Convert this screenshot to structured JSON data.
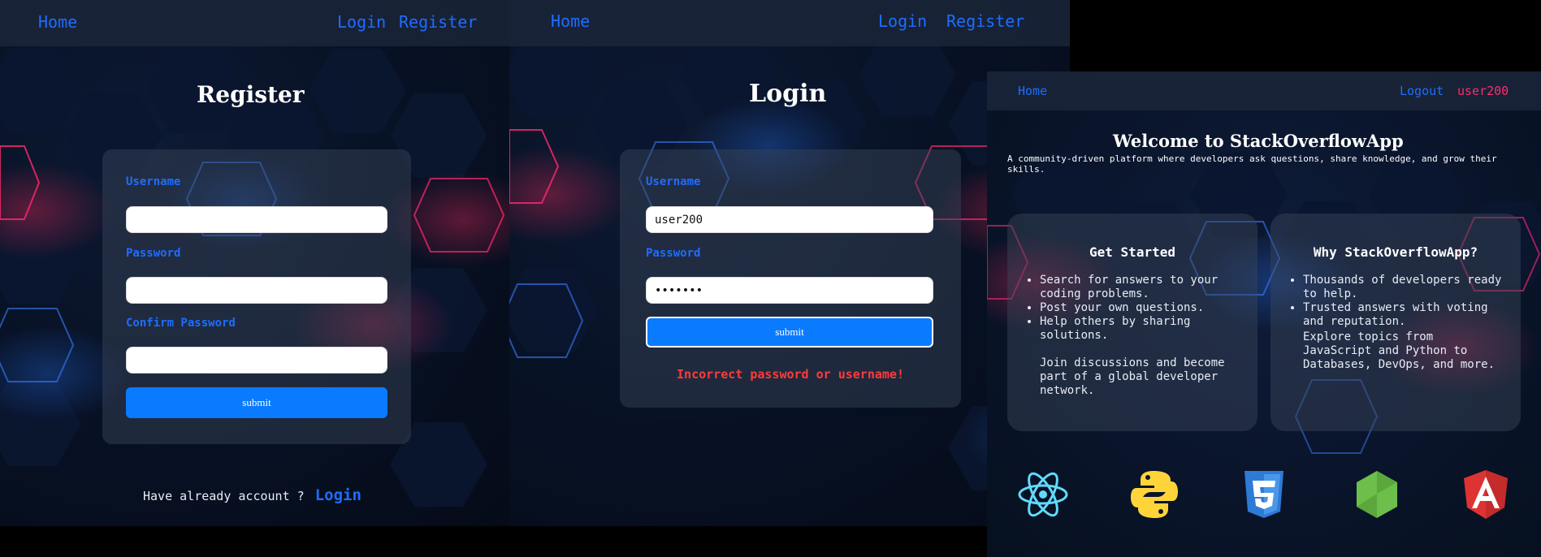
{
  "register": {
    "nav": {
      "home": "Home",
      "login": "Login",
      "register": "Register"
    },
    "title": "Register",
    "username_label": "Username",
    "password_label": "Password",
    "confirm_label": "Confirm Password",
    "submit": "submit",
    "footer_text": "Have already account ?",
    "footer_link": "Login"
  },
  "login": {
    "nav": {
      "home": "Home",
      "login": "Login",
      "register": "Register"
    },
    "title": "Login",
    "username_label": "Username",
    "username_value": "user200",
    "password_label": "Password",
    "password_value": "•••••••",
    "submit": "submit",
    "error": "Incorrect password or username!"
  },
  "home": {
    "nav": {
      "home": "Home",
      "logout": "Logout",
      "user": "user200"
    },
    "title": "Welcome to StackOverflowApp",
    "subtitle": "A community-driven platform where developers ask questions, share knowledge, and grow their skills.",
    "card1": {
      "title": "Get Started",
      "items": [
        "Search for answers to your coding problems.",
        "Post your own questions.",
        "Help others by sharing solutions."
      ],
      "text": "Join discussions and become part of a global developer network."
    },
    "card2": {
      "title": "Why StackOverflowApp?",
      "items": [
        "Thousands of developers ready to help.",
        "Trusted answers with voting and reputation."
      ],
      "text": "Explore topics from JavaScript and Python to Databases, DevOps, and more."
    },
    "tech_icons": [
      "react-icon",
      "python-icon",
      "css3-icon",
      "nodejs-icon",
      "angular-icon"
    ]
  },
  "colors": {
    "accent_blue": "#1e6dff",
    "button_blue": "#0a7bff",
    "error_red": "#ff3b3b",
    "username_pink": "#ff2a6d"
  }
}
